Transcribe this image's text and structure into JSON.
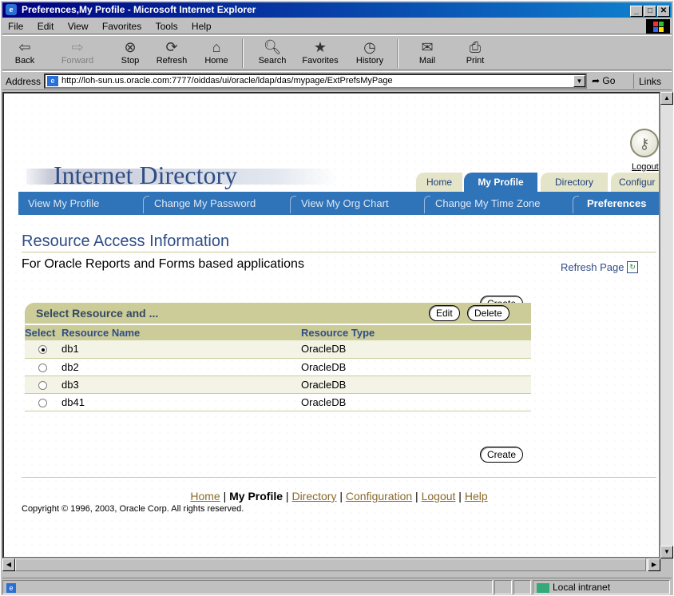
{
  "window": {
    "title": "Preferences,My Profile - Microsoft Internet Explorer"
  },
  "menu": [
    "File",
    "Edit",
    "View",
    "Favorites",
    "Tools",
    "Help"
  ],
  "toolbar": {
    "back": "Back",
    "forward": "Forward",
    "stop": "Stop",
    "refresh": "Refresh",
    "home": "Home",
    "search": "Search",
    "favorites": "Favorites",
    "history": "History",
    "mail": "Mail",
    "print": "Print"
  },
  "address": {
    "label": "Address",
    "url": "http://loh-sun.us.oracle.com:7777/oiddas/ui/oracle/ldap/das/mypage/ExtPrefsMyPage",
    "go": "Go",
    "links": "Links"
  },
  "page": {
    "logout": "Logout",
    "brand": "Internet Directory",
    "tabs": {
      "home": "Home",
      "my_profile": "My Profile",
      "directory": "Directory",
      "configuration": "Configur"
    },
    "subnav": {
      "view_profile": "View My Profile",
      "change_password": "Change My Password",
      "org_chart": "View My Org Chart",
      "time_zone": "Change My Time Zone",
      "preferences": "Preferences"
    },
    "heading": "Resource Access Information",
    "subheading": "For Oracle Reports and Forms based applications",
    "refresh_page": "Refresh Page",
    "buttons": {
      "create": "Create",
      "edit": "Edit",
      "delete": "Delete"
    },
    "table_title": "Select Resource and ...",
    "columns": {
      "select": "Select",
      "name": "Resource Name",
      "type": "Resource Type"
    },
    "rows": [
      {
        "name": "db1",
        "type": "OracleDB",
        "selected": true
      },
      {
        "name": "db2",
        "type": "OracleDB",
        "selected": false
      },
      {
        "name": "db3",
        "type": "OracleDB",
        "selected": false
      },
      {
        "name": "db41",
        "type": "OracleDB",
        "selected": false
      }
    ],
    "footer": {
      "home": "Home",
      "my_profile": "My Profile",
      "directory": "Directory",
      "configuration": "Configuration",
      "logout": "Logout",
      "help": "Help"
    },
    "copyright": "Copyright © 1996, 2003, Oracle Corp. All rights reserved."
  },
  "status": {
    "zone": "Local intranet"
  }
}
